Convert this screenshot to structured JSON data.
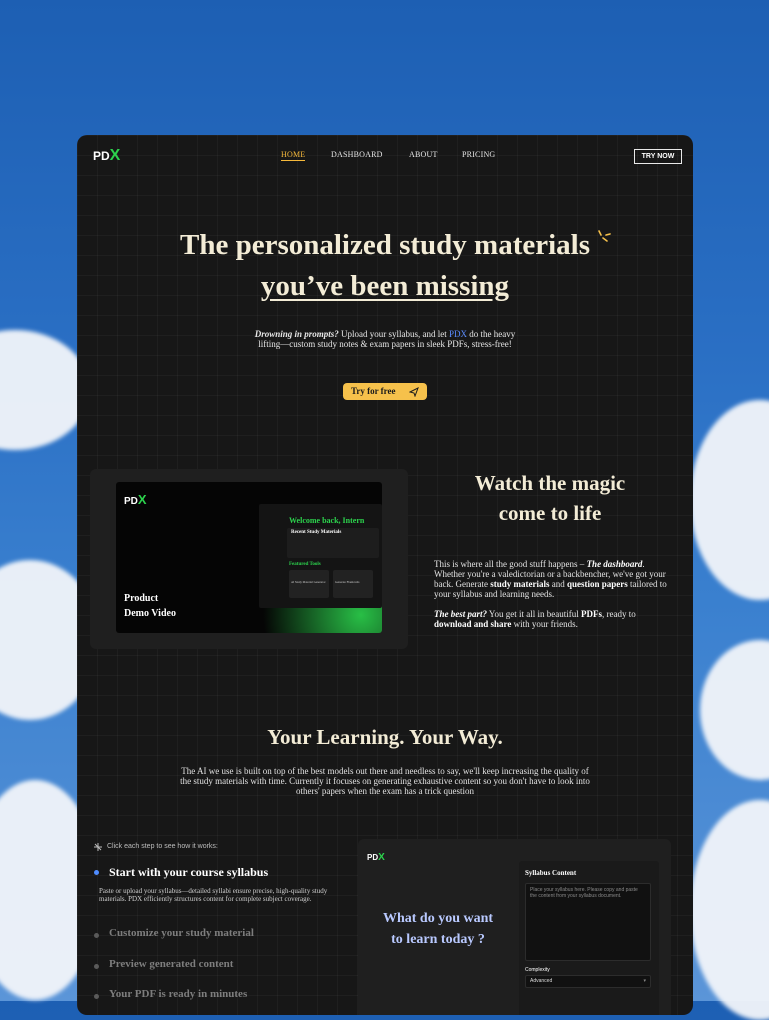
{
  "brand": {
    "logo_text": "PD",
    "logo_x": "X",
    "accent": "#2cd34d"
  },
  "nav": {
    "items": [
      {
        "label": "HOME",
        "active": true
      },
      {
        "label": "DASHBOARD",
        "active": false
      },
      {
        "label": "ABOUT",
        "active": false
      },
      {
        "label": "PRICING",
        "active": false
      }
    ],
    "cta": "TRY NOW"
  },
  "hero": {
    "title_line1": "The personalized study materials",
    "title_line2": "you’ve been missing",
    "sub_lead": "Drowning in prompts?",
    "sub_1": " Upload your syllabus, and let ",
    "sub_pdx": "PDX",
    "sub_2": " do the heavy lifting—custom study notes & exam papers in sleek PDFs, stress-free!",
    "cta": "Try for free"
  },
  "demo": {
    "video_label_1": "Product",
    "video_label_2": "Demo Video",
    "mini_welcome": "Welcome back, Intern",
    "mini_recent": "Recent Study Materials",
    "mini_featured": "Featured Tools",
    "mini_tool_1": "AI Study Material Generator",
    "mini_tool_2": "Generate Flashcards",
    "title_1": "Watch the magic",
    "title_2": "come to life",
    "para1_a": "This is where all the good stuff happens – ",
    "para1_b": "The dashboard",
    "para1_c": ". Whether you're a valedictorian or a backbencher, we've got your back. Generate ",
    "para1_d": "study materials",
    "para1_e": " and ",
    "para1_f": "question papers",
    "para1_g": " tailored to your syllabus and learning needs.",
    "para2_a": "The best part?",
    "para2_b": " You get it all in beautiful ",
    "para2_c": "PDFs",
    "para2_d": ", ready to ",
    "para2_e": "download and share",
    "para2_f": " with your friends."
  },
  "learning": {
    "title": "Your Learning. Your Way.",
    "body": "The AI we use is built on top of the best models out there and needless to say, we'll keep increasing the quality of the study materials with time. Currently it focuses on generating exhaustive content so you don't have to look into others' papers when the exam has a trick question"
  },
  "steps": {
    "hint": "Click each step to see how it works:",
    "items": [
      {
        "title": "Start with your course syllabus",
        "active": true,
        "desc": "Paste or upload your syllabus—detailed syllabi ensure precise, high-quality study materials. PDX efficiently structures content for complete subject coverage."
      },
      {
        "title": "Customize your study material",
        "active": false
      },
      {
        "title": "Preview generated content",
        "active": false
      },
      {
        "title": "Your PDF is ready in minutes",
        "active": false
      }
    ]
  },
  "panel": {
    "question_1": "What do you want",
    "question_2": "to learn today ?",
    "syllabus_label": "Syllabus Content",
    "syllabus_placeholder": "Place your syllabus here. Please copy and paste the content from your syllabus document.",
    "complexity_label": "Complexity",
    "complexity_value": "Advanced"
  }
}
